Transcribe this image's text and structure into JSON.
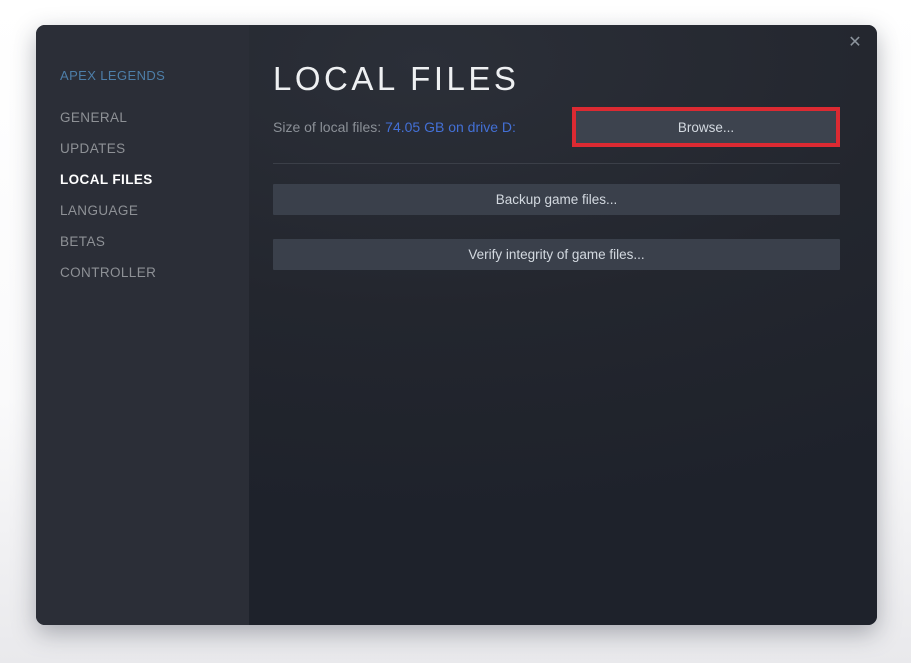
{
  "window": {
    "close_icon": "✕"
  },
  "sidebar": {
    "game_title": "APEX LEGENDS",
    "items": [
      {
        "label": "GENERAL",
        "active": false
      },
      {
        "label": "UPDATES",
        "active": false
      },
      {
        "label": "LOCAL FILES",
        "active": true
      },
      {
        "label": "LANGUAGE",
        "active": false
      },
      {
        "label": "BETAS",
        "active": false
      },
      {
        "label": "CONTROLLER",
        "active": false
      }
    ]
  },
  "main": {
    "title": "LOCAL FILES",
    "size_label": "Size of local files:",
    "size_value": "74.05 GB on drive D:",
    "browse_button": "Browse...",
    "backup_button": "Backup game files...",
    "verify_button": "Verify integrity of game files..."
  },
  "colors": {
    "sidebar_bg": "#2b2e37",
    "main_bg": "#23262e",
    "game_title_blue": "#4d7ea8",
    "size_value_blue": "#4370d6",
    "highlight_red": "#dc2a32",
    "button_bg": "#3d434e",
    "active_item": "#ffffff",
    "inactive_item": "#8e9196"
  }
}
